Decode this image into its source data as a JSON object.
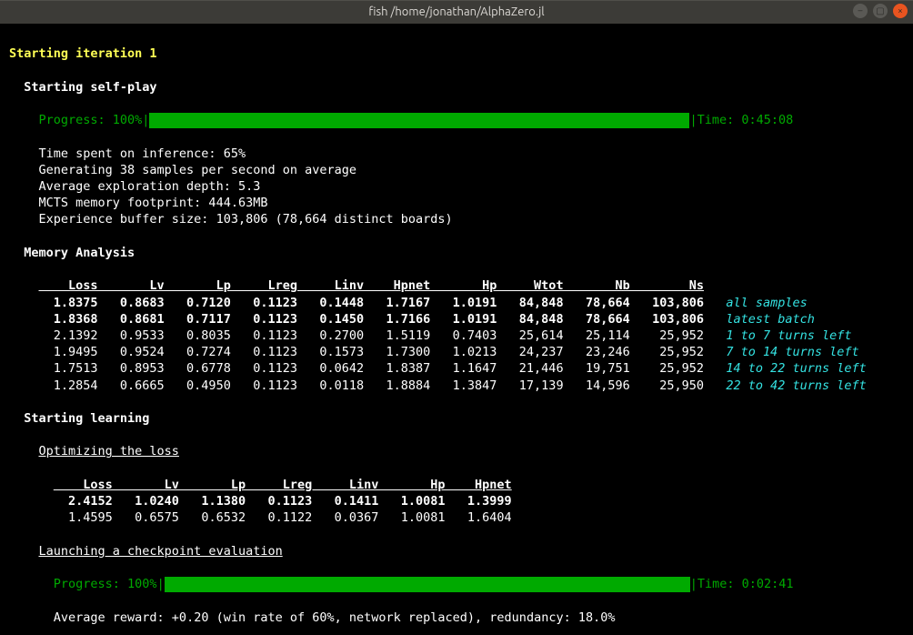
{
  "window": {
    "title": "fish  /home/jonathan/AlphaZero.jl"
  },
  "iteration_header": "Starting iteration 1",
  "selfplay": {
    "header": "Starting self-play",
    "progress_label": "Progress: 100%",
    "time_label": " Time: 0:45:08",
    "stats": {
      "inference": "Time spent on inference: 65%",
      "samples": "Generating 38 samples per second on average",
      "depth": "Average exploration depth: 5.3",
      "mcts": "MCTS memory footprint: 444.63MB",
      "buffer": "Experience buffer size: 103,806 (78,664 distinct boards)"
    }
  },
  "memory": {
    "header": "Memory Analysis",
    "columns": [
      "Loss",
      "Lv",
      "Lp",
      "Lreg",
      "Linv",
      "Hpnet",
      "Hp",
      "Wtot",
      "Nb",
      "Ns"
    ],
    "rows": [
      {
        "bold": true,
        "label": "all samples",
        "vals": [
          "1.8375",
          "0.8683",
          "0.7120",
          "0.1123",
          "0.1448",
          "1.7167",
          "1.0191",
          "84,848",
          "78,664",
          "103,806"
        ]
      },
      {
        "bold": true,
        "label": "latest batch",
        "vals": [
          "1.8368",
          "0.8681",
          "0.7117",
          "0.1123",
          "0.1450",
          "1.7166",
          "1.0191",
          "84,848",
          "78,664",
          "103,806"
        ]
      },
      {
        "bold": false,
        "label": "1 to 7 turns left",
        "vals": [
          "2.1392",
          "0.9533",
          "0.8035",
          "0.1123",
          "0.2700",
          "1.5119",
          "0.7403",
          "25,614",
          "25,114",
          "25,952"
        ]
      },
      {
        "bold": false,
        "label": "7 to 14 turns left",
        "vals": [
          "1.9495",
          "0.9524",
          "0.7274",
          "0.1123",
          "0.1573",
          "1.7300",
          "1.0213",
          "24,237",
          "23,246",
          "25,952"
        ]
      },
      {
        "bold": false,
        "label": "14 to 22 turns left",
        "vals": [
          "1.7513",
          "0.8953",
          "0.6778",
          "0.1123",
          "0.0642",
          "1.8387",
          "1.1647",
          "21,446",
          "19,751",
          "25,952"
        ]
      },
      {
        "bold": false,
        "label": "22 to 42 turns left",
        "vals": [
          "1.2854",
          "0.6665",
          "0.4950",
          "0.1123",
          "0.0118",
          "1.8884",
          "1.3847",
          "17,139",
          "14,596",
          "25,950"
        ]
      }
    ]
  },
  "learning": {
    "header": "Starting learning",
    "opt_header": "Optimizing the loss",
    "columns": [
      "Loss",
      "Lv",
      "Lp",
      "Lreg",
      "Linv",
      "Hp",
      "Hpnet"
    ],
    "rows": [
      {
        "bold": true,
        "vals": [
          "2.4152",
          "1.0240",
          "1.1380",
          "0.1123",
          "0.1411",
          "1.0081",
          "1.3999"
        ]
      },
      {
        "bold": false,
        "vals": [
          "1.4595",
          "0.6575",
          "0.6532",
          "0.1122",
          "0.0367",
          "1.0081",
          "1.6404"
        ]
      }
    ],
    "eval_header": "Launching a checkpoint evaluation",
    "progress_label": "Progress: 100%",
    "time_label": " Time: 0:02:41",
    "reward": "Average reward: +0.20 (win rate of 60%, network replaced), redundancy: 18.0%"
  }
}
